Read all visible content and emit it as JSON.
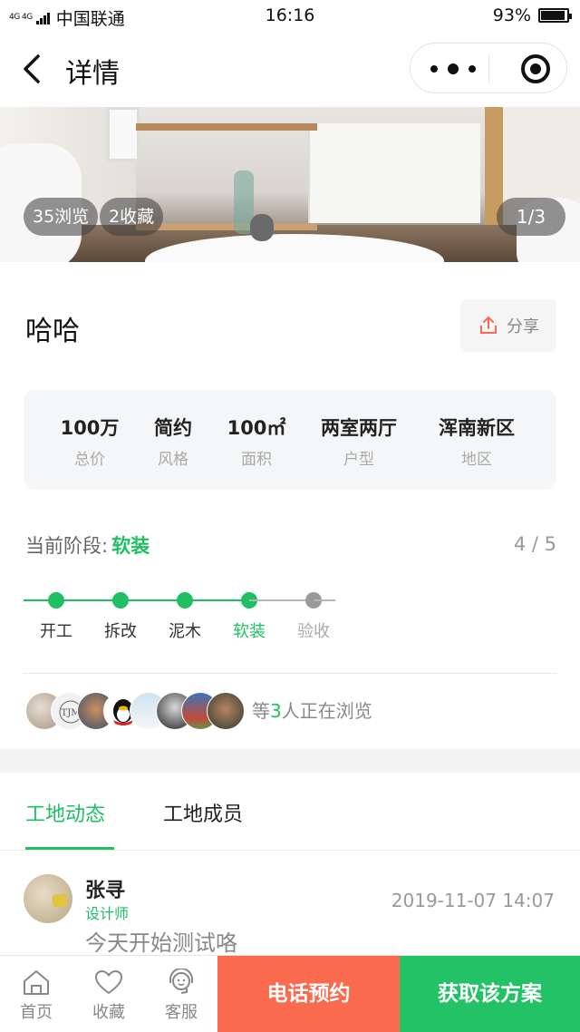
{
  "status_bar": {
    "network_label": "4G 4G",
    "carrier": "中国联通",
    "time": "16:16",
    "battery": "93%",
    "battery_level": 0.93
  },
  "nav": {
    "title": "详情",
    "icons": [
      "chevron-left-icon",
      "more-dots-icon",
      "target-icon"
    ]
  },
  "hero": {
    "views": "35浏览",
    "favorites": "2收藏",
    "pager": "1/3"
  },
  "project": {
    "title": "哈哈",
    "share_label": "分享"
  },
  "info": [
    {
      "value": "100万",
      "label": "总价"
    },
    {
      "value": "简约",
      "label": "风格"
    },
    {
      "value": "100㎡",
      "label": "面积"
    },
    {
      "value": "两室两厅",
      "label": "户型"
    },
    {
      "value": "浑南新区",
      "label": "地区"
    }
  ],
  "stage": {
    "label": "当前阶段:",
    "current": "软装",
    "progress": "4 / 5",
    "steps": [
      {
        "name": "开工",
        "done": true
      },
      {
        "name": "拆改",
        "done": true
      },
      {
        "name": "泥木",
        "done": true
      },
      {
        "name": "软装",
        "done": true,
        "current": true
      },
      {
        "name": "验收",
        "done": false
      }
    ]
  },
  "viewers": {
    "prefix": "等",
    "count": "3",
    "suffix": "人正在浏览"
  },
  "tabs": {
    "active": "工地动态",
    "inactive": "工地成员"
  },
  "feed": {
    "name": "张寻",
    "role": "设计师",
    "time": "2019-11-07 14:07",
    "content": "今天开始测试咯"
  },
  "bottom": {
    "home": "首页",
    "favorite": "收藏",
    "service": "客服",
    "call": "电话预约",
    "get_plan": "获取该方案"
  },
  "colors": {
    "accent": "#1fc064",
    "call_button": "#f96a4f",
    "plan_button": "#23c266",
    "pending": "#9a9a9a"
  }
}
